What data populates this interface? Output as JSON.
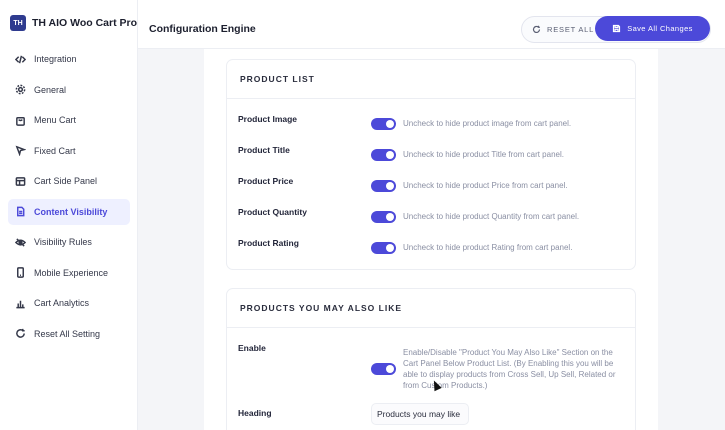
{
  "brand": {
    "logo_text": "TH",
    "name": "TH AIO Woo Cart Pro"
  },
  "sidebar": {
    "items": [
      {
        "label": "Integration",
        "icon": "code-icon"
      },
      {
        "label": "General",
        "icon": "gear-icon"
      },
      {
        "label": "Menu Cart",
        "icon": "bag-icon"
      },
      {
        "label": "Fixed Cart",
        "icon": "pointer-icon"
      },
      {
        "label": "Cart Side Panel",
        "icon": "panel-icon"
      },
      {
        "label": "Content Visibility",
        "icon": "document-icon",
        "active": true
      },
      {
        "label": "Visibility Rules",
        "icon": "eye-off-icon"
      },
      {
        "label": "Mobile Experience",
        "icon": "mobile-icon"
      },
      {
        "label": "Cart Analytics",
        "icon": "chart-icon"
      },
      {
        "label": "Reset All Setting",
        "icon": "refresh-icon"
      }
    ]
  },
  "header": {
    "title": "Configuration Engine",
    "reset_label": "RESET ALL",
    "save_label": "Save All Changes"
  },
  "product_list": {
    "title": "PRODUCT LIST",
    "rows": [
      {
        "label": "Product Image",
        "enabled": true,
        "desc": "Uncheck to hide product image from cart panel."
      },
      {
        "label": "Product Title",
        "enabled": true,
        "desc": "Uncheck to hide product Title from cart panel."
      },
      {
        "label": "Product Price",
        "enabled": true,
        "desc": "Uncheck to hide product Price from cart panel."
      },
      {
        "label": "Product Quantity",
        "enabled": true,
        "desc": "Uncheck to hide product Quantity from cart panel."
      },
      {
        "label": "Product Rating",
        "enabled": true,
        "desc": "Uncheck to hide product Rating from cart panel."
      }
    ]
  },
  "also_like": {
    "title": "PRODUCTS YOU MAY ALSO LIKE",
    "enable_label": "Enable",
    "enable_on": true,
    "enable_desc": "Enable/Disable \"Product You May Also Like\" Section on the Cart Panel Below Product List. (By Enabling this you will be able to display products from Cross Sell, Up Sell, Related or from Custom Products.)",
    "heading_label": "Heading",
    "heading_value": "Products you may like"
  },
  "colors": {
    "accent": "#4c49d9",
    "active_bg": "#eef0ff"
  }
}
